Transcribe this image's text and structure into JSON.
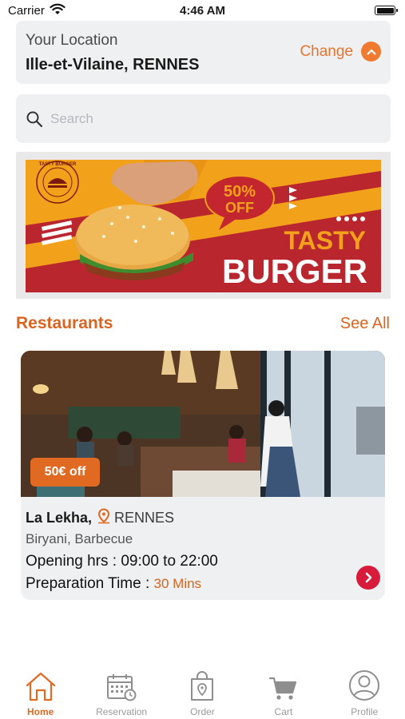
{
  "status_bar": {
    "carrier": "Carrier",
    "time": "4:46 AM"
  },
  "location": {
    "label": "Your Location",
    "value": "Ille-et-Vilaine, RENNES",
    "change_label": "Change"
  },
  "search": {
    "placeholder": "Search"
  },
  "banner": {
    "logo_text": "TASTY BURGER",
    "offer_line1": "50%",
    "offer_line2": "OFF",
    "headline1": "TASTY",
    "headline2": "BURGER"
  },
  "section": {
    "title": "Restaurants",
    "see_all": "See All"
  },
  "restaurant": {
    "discount": "50€ off",
    "name": "La Lekha,",
    "city": "RENNES",
    "cuisine": "Biryani, Barbecue",
    "hours": "Opening hrs : 09:00 to 22:00",
    "prep_label": "Preparation Time :",
    "prep_value": "30 Mins"
  },
  "tabs": [
    {
      "label": "Home",
      "icon": "home-icon",
      "active": true
    },
    {
      "label": "Reservation",
      "icon": "calendar-icon",
      "active": false
    },
    {
      "label": "Order",
      "icon": "shopping-bag-icon",
      "active": false
    },
    {
      "label": "Cart",
      "icon": "cart-icon",
      "active": false
    },
    {
      "label": "Profile",
      "icon": "user-icon",
      "active": false
    }
  ],
  "colors": {
    "accent": "#e06a22",
    "arrow_button": "#d81b3a",
    "card_bg": "#eef0f2"
  }
}
